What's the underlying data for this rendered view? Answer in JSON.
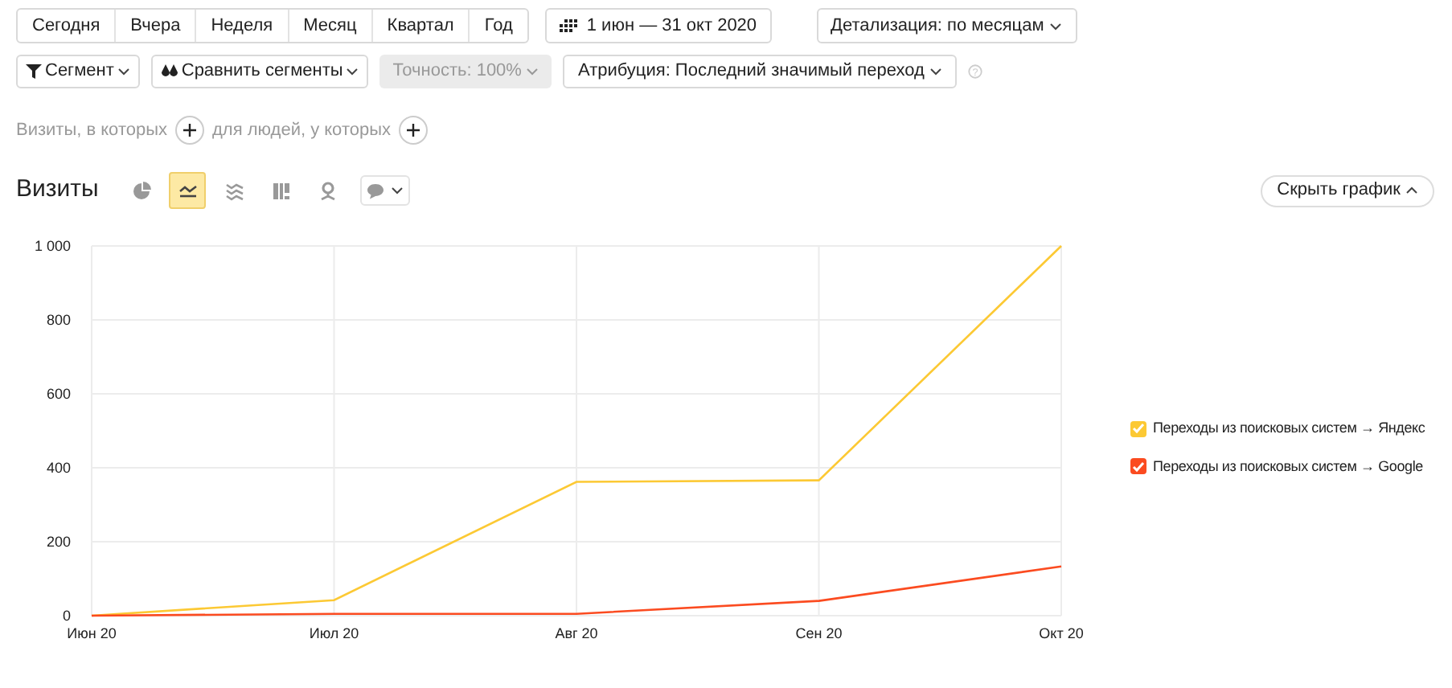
{
  "periods": [
    "Сегодня",
    "Вчера",
    "Неделя",
    "Месяц",
    "Квартал",
    "Год"
  ],
  "date_range": "1 июн — 31 окт 2020",
  "detail": "Детализация: по месяцам",
  "segment": "Сегмент",
  "compare": "Сравнить сегменты",
  "accuracy": {
    "label": "Точность: 100%",
    "disabled": true
  },
  "attribution": "Атрибуция: Последний значимый переход",
  "filters": {
    "visits_label": "Визиты, в которых",
    "people_label": "для людей, у которых"
  },
  "report": {
    "title": "Визиты",
    "hide_chart": "Скрыть график",
    "chart_types": [
      {
        "kind": "pie",
        "selected": false
      },
      {
        "kind": "line",
        "selected": true
      },
      {
        "kind": "stacked",
        "selected": false
      },
      {
        "kind": "bars",
        "selected": false
      },
      {
        "kind": "map",
        "selected": false
      }
    ]
  },
  "help": "?",
  "legend": [
    {
      "checked": true
    },
    {
      "checked": true
    }
  ],
  "chart_data": {
    "type": "line",
    "grid": true,
    "categories": [
      "Июн 20",
      "Июл 20",
      "Авг 20",
      "Сен 20",
      "Окт 20"
    ],
    "ylim": [
      0,
      1000
    ],
    "yticks": [
      0,
      200,
      400,
      600,
      800,
      {
        "value": 1000,
        "label": "1 000"
      }
    ],
    "series": [
      {
        "name": "Переходы из поисковых систем → Яндекс",
        "color": "#fcc934",
        "values": [
          0,
          42,
          362,
          366,
          1000
        ]
      },
      {
        "name": "Переходы из поисковых систем → Google",
        "color": "#fb4b20",
        "values": [
          0,
          5,
          5,
          40,
          133
        ]
      }
    ]
  }
}
